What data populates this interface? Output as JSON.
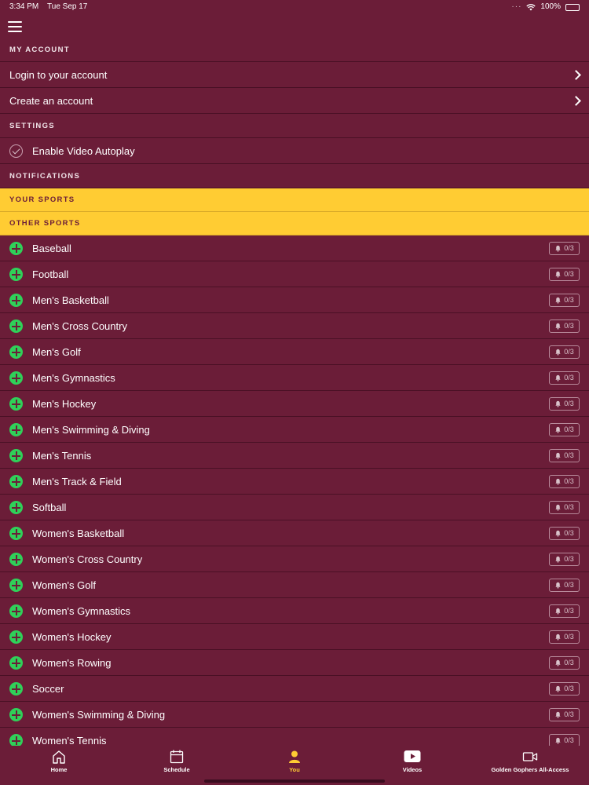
{
  "status_bar": {
    "time": "3:34 PM",
    "date": "Tue Sep 17",
    "battery": "100%"
  },
  "sections": {
    "my_account": "MY ACCOUNT",
    "settings": "SETTINGS",
    "notifications": "NOTIFICATIONS",
    "your_sports": "YOUR SPORTS",
    "other_sports": "OTHER SPORTS"
  },
  "account": {
    "login_label": "Login to your account",
    "create_label": "Create an account"
  },
  "settings": {
    "autoplay_label": "Enable Video Autoplay"
  },
  "sports": [
    {
      "name": "Baseball",
      "count": "0/3"
    },
    {
      "name": "Football",
      "count": "0/3"
    },
    {
      "name": "Men's Basketball",
      "count": "0/3"
    },
    {
      "name": "Men's Cross Country",
      "count": "0/3"
    },
    {
      "name": "Men's Golf",
      "count": "0/3"
    },
    {
      "name": "Men's Gymnastics",
      "count": "0/3"
    },
    {
      "name": "Men's Hockey",
      "count": "0/3"
    },
    {
      "name": "Men's Swimming & Diving",
      "count": "0/3"
    },
    {
      "name": "Men's Tennis",
      "count": "0/3"
    },
    {
      "name": "Men's Track & Field",
      "count": "0/3"
    },
    {
      "name": "Softball",
      "count": "0/3"
    },
    {
      "name": "Women's Basketball",
      "count": "0/3"
    },
    {
      "name": "Women's Cross Country",
      "count": "0/3"
    },
    {
      "name": "Women's Golf",
      "count": "0/3"
    },
    {
      "name": "Women's Gymnastics",
      "count": "0/3"
    },
    {
      "name": "Women's Hockey",
      "count": "0/3"
    },
    {
      "name": "Women's Rowing",
      "count": "0/3"
    },
    {
      "name": "Soccer",
      "count": "0/3"
    },
    {
      "name": "Women's Swimming & Diving",
      "count": "0/3"
    },
    {
      "name": "Women's Tennis",
      "count": "0/3"
    }
  ],
  "tabs": [
    {
      "label": "Home",
      "icon": "home-icon"
    },
    {
      "label": "Schedule",
      "icon": "calendar-icon"
    },
    {
      "label": "You",
      "icon": "person-icon"
    },
    {
      "label": "Videos",
      "icon": "play-icon"
    },
    {
      "label": "Golden Gophers All-Access",
      "icon": "video-camera-icon"
    }
  ],
  "colors": {
    "background": "#6b1d38",
    "gold": "#ffcc33",
    "add_green": "#2fd159"
  }
}
